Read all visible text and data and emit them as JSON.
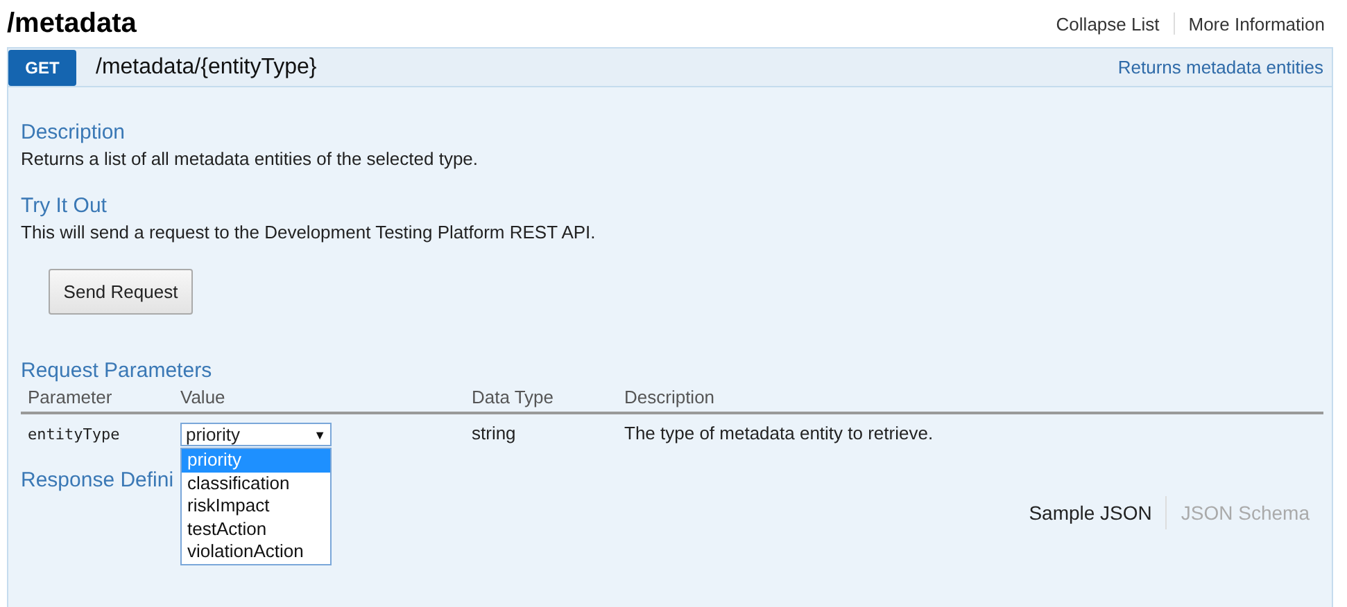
{
  "page_title": "/metadata",
  "header_links": [
    {
      "label": "Collapse List"
    },
    {
      "label": "More Information"
    }
  ],
  "endpoint": {
    "method": "GET",
    "path": "/metadata/{entityType}",
    "summary": "Returns metadata entities"
  },
  "sections": [
    {
      "heading": "Description",
      "text": "Returns a list of all metadata entities of the selected type."
    },
    {
      "heading": "Try It Out",
      "text": "This will send a request to the Development Testing Platform REST API.",
      "button": "Send Request"
    }
  ],
  "parameters": {
    "heading": "Request Parameters",
    "columns": [
      "Parameter",
      "Value",
      "Data Type",
      "Description"
    ],
    "rows": [
      {
        "name": "entityType",
        "value": "priority",
        "caret": "▼",
        "options": [
          {
            "label": "priority",
            "selected": true
          },
          {
            "label": "classification",
            "selected": false
          },
          {
            "label": "riskImpact",
            "selected": false
          },
          {
            "label": "testAction",
            "selected": false
          },
          {
            "label": "violationAction",
            "selected": false
          }
        ],
        "data_type": "string",
        "description": "The type of metadata entity to retrieve."
      }
    ]
  },
  "response": {
    "heading": "Response Defini",
    "tabs": [
      {
        "label": "Sample JSON",
        "selected": true
      },
      {
        "label": "JSON Schema",
        "selected": false
      }
    ]
  }
}
